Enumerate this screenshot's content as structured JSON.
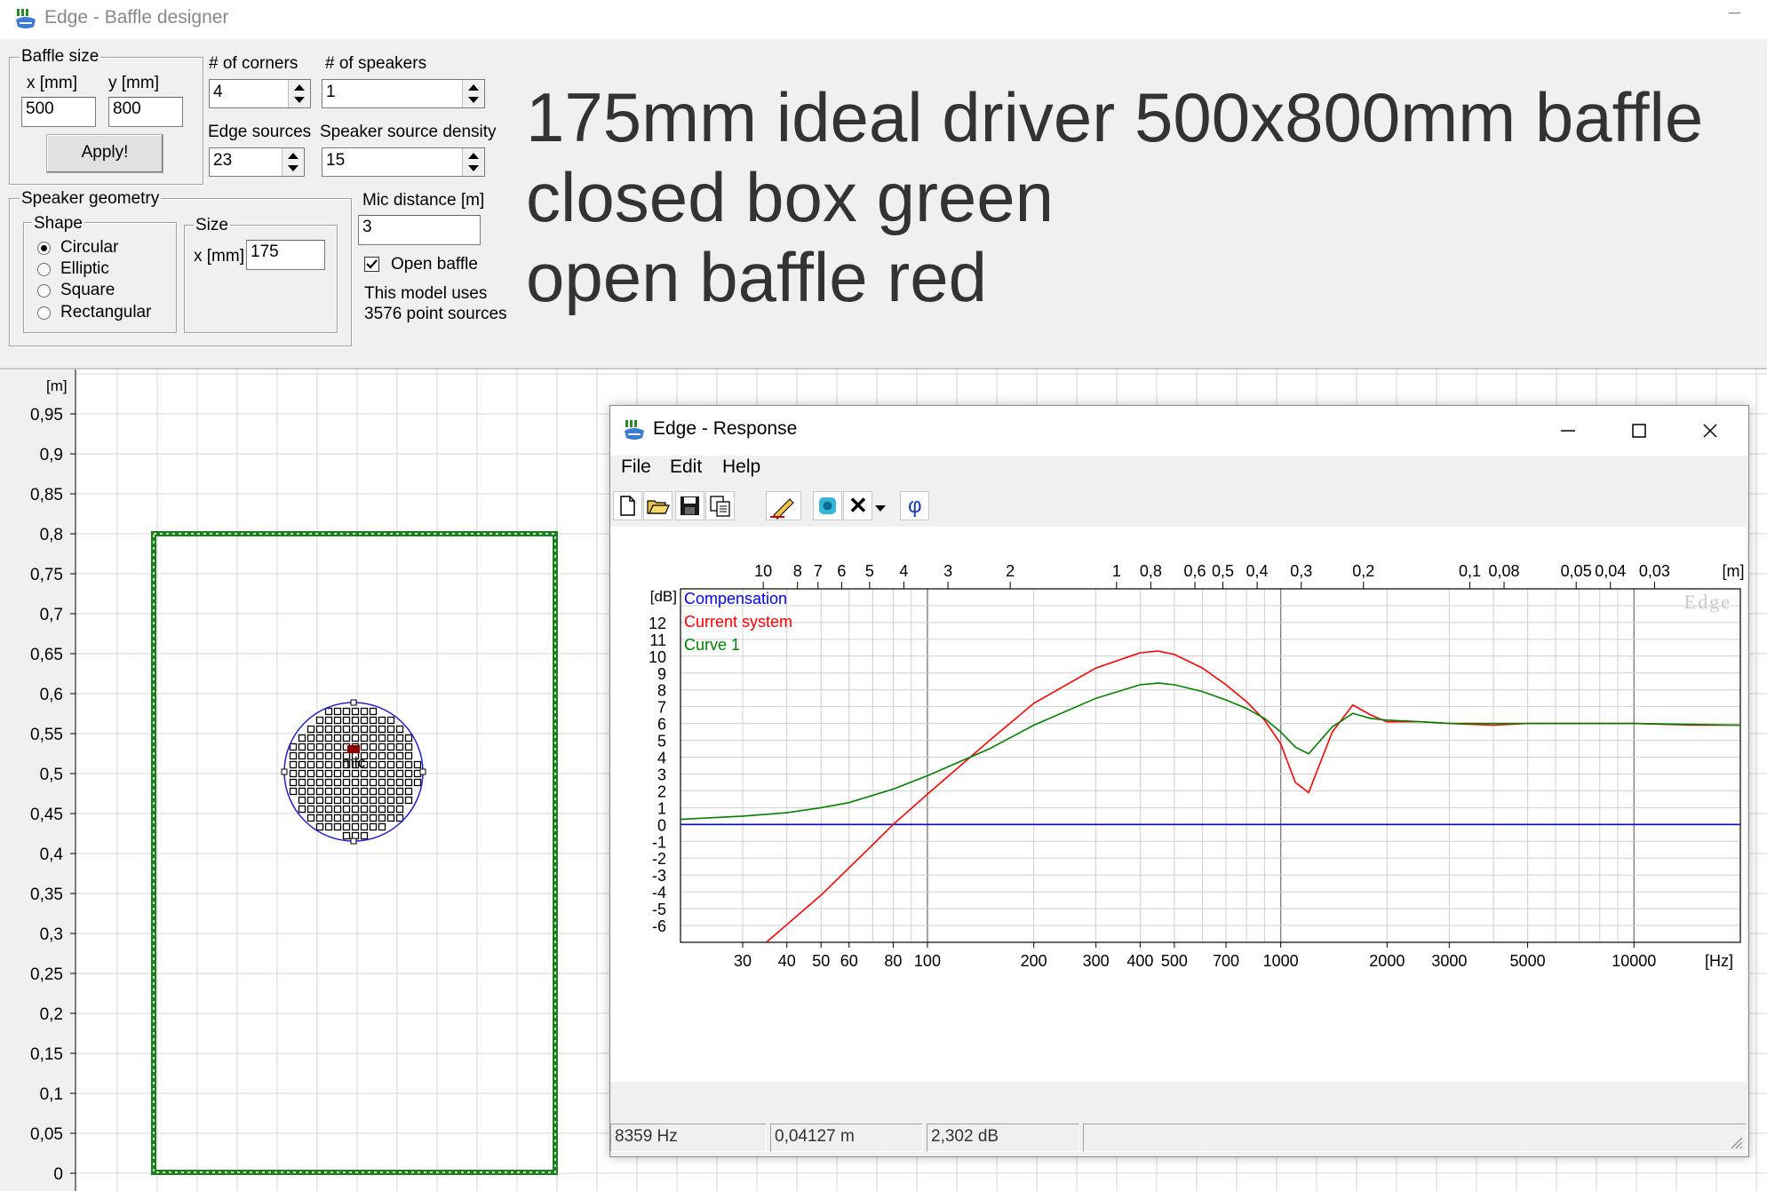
{
  "titlebar": {
    "title": "Edge - Baffle designer",
    "minimize": "–"
  },
  "baffle_size": {
    "label": "Baffle size",
    "x_label": "x [mm]",
    "y_label": "y [mm]",
    "x_value": "500",
    "y_value": "800",
    "apply_label": "Apply!"
  },
  "corners": {
    "label": "# of corners",
    "value": "4"
  },
  "speakers": {
    "label": "# of speakers",
    "value": "1"
  },
  "edge_sources": {
    "label": "Edge sources",
    "value": "23"
  },
  "source_density": {
    "label": "Speaker source density",
    "value": "15"
  },
  "geometry": {
    "label": "Speaker geometry",
    "shape_label": "Shape",
    "shapes": [
      "Circular",
      "Elliptic",
      "Square",
      "Rectangular"
    ],
    "selected_shape": "Circular",
    "size_label": "Size",
    "size_x_label": "x [mm]",
    "size_x_value": "175"
  },
  "mic": {
    "label": "Mic distance [m]",
    "value": "3"
  },
  "open_baffle": {
    "label": "Open baffle",
    "checked": true
  },
  "model_info": {
    "line1": "This model uses",
    "line2": "3576 point sources"
  },
  "annotation": {
    "line1": "175mm ideal driver 500x800mm baffle",
    "line2": "closed box green",
    "line3": "open baffle red"
  },
  "baffle_plot": {
    "unit": "[m]",
    "y_ticks": [
      "0,95",
      "0,9",
      "0,85",
      "0,8",
      "0,75",
      "0,7",
      "0,65",
      "0,6",
      "0,55",
      "0,5",
      "0,45",
      "0,4",
      "0,35",
      "0,3",
      "0,25",
      "0,2",
      "0,15",
      "0,1",
      "0,05",
      "0"
    ],
    "mic_label": "mic",
    "colors": {
      "baffle": "#1e7d1e",
      "driver_outline": "#2222cc",
      "mic_marker": "#8b0000"
    }
  },
  "response": {
    "title": "Edge - Response",
    "menu": [
      "File",
      "Edit",
      "Help"
    ],
    "toolbar_icons": [
      "new-file-icon",
      "open-folder-icon",
      "save-icon",
      "copy-icon",
      "pencil-icon",
      "speaker-icon",
      "delete-icon",
      "dropdown-icon",
      "phase-icon"
    ],
    "phase_glyph": "φ",
    "delete_glyph": "✕",
    "status": {
      "freq": "8359 Hz",
      "dist": "0,04127 m",
      "level": "2,302 dB"
    },
    "watermark": "Edge"
  },
  "chart_data": {
    "type": "line",
    "xlabel": "[Hz]",
    "ylabel": "[dB]",
    "x_scale": "log",
    "xlim": [
      20,
      20000
    ],
    "ylim": [
      -7,
      14
    ],
    "x_tick_labels": [
      "30",
      "40",
      "50",
      "60",
      "80",
      "100",
      "200",
      "300",
      "400",
      "500",
      "700",
      "1000",
      "2000",
      "3000",
      "5000",
      "10000"
    ],
    "x_tick_values": [
      30,
      40,
      50,
      60,
      80,
      100,
      200,
      300,
      400,
      500,
      700,
      1000,
      2000,
      3000,
      5000,
      10000
    ],
    "y_ticks": [
      -6,
      -5,
      -4,
      -3,
      -2,
      -1,
      0,
      1,
      2,
      3,
      4,
      5,
      6,
      7,
      8,
      9,
      10,
      11,
      12
    ],
    "top_axis": {
      "label": "[m]",
      "tick_labels": [
        "10",
        "8",
        "7",
        "6",
        "5",
        "4",
        "3",
        "2",
        "1",
        "0,8",
        "0,6",
        "0,5",
        "0,4",
        "0,3",
        "0,2",
        "0,1",
        "0,08",
        "0,05",
        "0,04",
        "0,03"
      ],
      "tick_values": [
        10,
        8,
        7,
        6,
        5,
        4,
        3,
        2,
        1,
        0.8,
        0.6,
        0.5,
        0.4,
        0.3,
        0.2,
        0.1,
        0.08,
        0.05,
        0.04,
        0.03
      ]
    },
    "grid": true,
    "legend_position": "top-left",
    "series": [
      {
        "name": "Compensation",
        "color": "#0000ff",
        "x": [
          20,
          20000
        ],
        "y": [
          0,
          0
        ]
      },
      {
        "name": "Current system",
        "color": "#ff0000",
        "x": [
          35,
          50,
          70,
          80,
          100,
          150,
          200,
          300,
          400,
          450,
          500,
          600,
          700,
          800,
          900,
          1000,
          1100,
          1200,
          1400,
          1600,
          1800,
          2000,
          2500,
          3000,
          4000,
          5000,
          7000,
          10000,
          15000,
          20000
        ],
        "y": [
          -7,
          -4.2,
          -1.2,
          0,
          1.8,
          5,
          7.2,
          9.3,
          10.2,
          10.3,
          10.1,
          9.3,
          8.3,
          7.3,
          6.2,
          4.8,
          2.5,
          1.9,
          5.5,
          7.1,
          6.5,
          6.1,
          6.1,
          6.0,
          5.9,
          6.0,
          6.0,
          6.0,
          5.9,
          5.9
        ]
      },
      {
        "name": "Curve 1",
        "color": "#008000",
        "x": [
          20,
          30,
          40,
          50,
          60,
          80,
          100,
          150,
          200,
          300,
          400,
          450,
          500,
          600,
          700,
          800,
          900,
          1000,
          1100,
          1200,
          1400,
          1600,
          1800,
          2000,
          2500,
          3000,
          5000,
          10000,
          20000
        ],
        "y": [
          0.3,
          0.5,
          0.7,
          1.0,
          1.3,
          2.1,
          2.9,
          4.5,
          5.9,
          7.5,
          8.3,
          8.4,
          8.3,
          7.9,
          7.4,
          6.9,
          6.3,
          5.5,
          4.6,
          4.2,
          5.8,
          6.6,
          6.3,
          6.2,
          6.1,
          6.0,
          6.0,
          6.0,
          5.9
        ]
      }
    ]
  }
}
